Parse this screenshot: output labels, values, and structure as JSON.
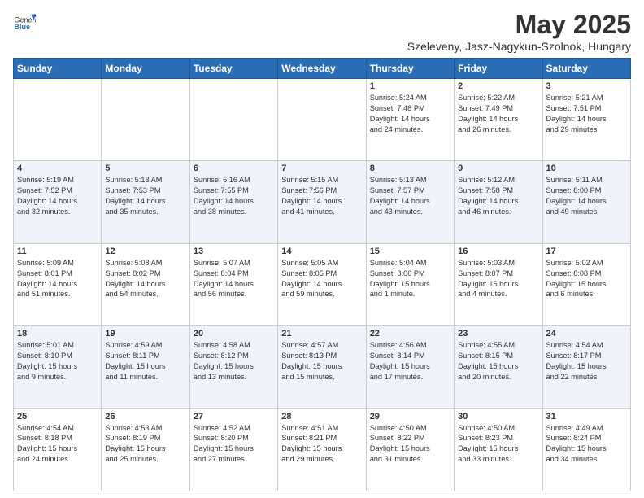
{
  "header": {
    "logo_general": "General",
    "logo_blue": "Blue",
    "main_title": "May 2025",
    "sub_title": "Szeleveny, Jasz-Nagykun-Szolnok, Hungary"
  },
  "weekdays": [
    "Sunday",
    "Monday",
    "Tuesday",
    "Wednesday",
    "Thursday",
    "Friday",
    "Saturday"
  ],
  "weeks": [
    [
      {
        "day": "",
        "info": ""
      },
      {
        "day": "",
        "info": ""
      },
      {
        "day": "",
        "info": ""
      },
      {
        "day": "",
        "info": ""
      },
      {
        "day": "1",
        "info": "Sunrise: 5:24 AM\nSunset: 7:48 PM\nDaylight: 14 hours\nand 24 minutes."
      },
      {
        "day": "2",
        "info": "Sunrise: 5:22 AM\nSunset: 7:49 PM\nDaylight: 14 hours\nand 26 minutes."
      },
      {
        "day": "3",
        "info": "Sunrise: 5:21 AM\nSunset: 7:51 PM\nDaylight: 14 hours\nand 29 minutes."
      }
    ],
    [
      {
        "day": "4",
        "info": "Sunrise: 5:19 AM\nSunset: 7:52 PM\nDaylight: 14 hours\nand 32 minutes."
      },
      {
        "day": "5",
        "info": "Sunrise: 5:18 AM\nSunset: 7:53 PM\nDaylight: 14 hours\nand 35 minutes."
      },
      {
        "day": "6",
        "info": "Sunrise: 5:16 AM\nSunset: 7:55 PM\nDaylight: 14 hours\nand 38 minutes."
      },
      {
        "day": "7",
        "info": "Sunrise: 5:15 AM\nSunset: 7:56 PM\nDaylight: 14 hours\nand 41 minutes."
      },
      {
        "day": "8",
        "info": "Sunrise: 5:13 AM\nSunset: 7:57 PM\nDaylight: 14 hours\nand 43 minutes."
      },
      {
        "day": "9",
        "info": "Sunrise: 5:12 AM\nSunset: 7:58 PM\nDaylight: 14 hours\nand 46 minutes."
      },
      {
        "day": "10",
        "info": "Sunrise: 5:11 AM\nSunset: 8:00 PM\nDaylight: 14 hours\nand 49 minutes."
      }
    ],
    [
      {
        "day": "11",
        "info": "Sunrise: 5:09 AM\nSunset: 8:01 PM\nDaylight: 14 hours\nand 51 minutes."
      },
      {
        "day": "12",
        "info": "Sunrise: 5:08 AM\nSunset: 8:02 PM\nDaylight: 14 hours\nand 54 minutes."
      },
      {
        "day": "13",
        "info": "Sunrise: 5:07 AM\nSunset: 8:04 PM\nDaylight: 14 hours\nand 56 minutes."
      },
      {
        "day": "14",
        "info": "Sunrise: 5:05 AM\nSunset: 8:05 PM\nDaylight: 14 hours\nand 59 minutes."
      },
      {
        "day": "15",
        "info": "Sunrise: 5:04 AM\nSunset: 8:06 PM\nDaylight: 15 hours\nand 1 minute."
      },
      {
        "day": "16",
        "info": "Sunrise: 5:03 AM\nSunset: 8:07 PM\nDaylight: 15 hours\nand 4 minutes."
      },
      {
        "day": "17",
        "info": "Sunrise: 5:02 AM\nSunset: 8:08 PM\nDaylight: 15 hours\nand 6 minutes."
      }
    ],
    [
      {
        "day": "18",
        "info": "Sunrise: 5:01 AM\nSunset: 8:10 PM\nDaylight: 15 hours\nand 9 minutes."
      },
      {
        "day": "19",
        "info": "Sunrise: 4:59 AM\nSunset: 8:11 PM\nDaylight: 15 hours\nand 11 minutes."
      },
      {
        "day": "20",
        "info": "Sunrise: 4:58 AM\nSunset: 8:12 PM\nDaylight: 15 hours\nand 13 minutes."
      },
      {
        "day": "21",
        "info": "Sunrise: 4:57 AM\nSunset: 8:13 PM\nDaylight: 15 hours\nand 15 minutes."
      },
      {
        "day": "22",
        "info": "Sunrise: 4:56 AM\nSunset: 8:14 PM\nDaylight: 15 hours\nand 17 minutes."
      },
      {
        "day": "23",
        "info": "Sunrise: 4:55 AM\nSunset: 8:15 PM\nDaylight: 15 hours\nand 20 minutes."
      },
      {
        "day": "24",
        "info": "Sunrise: 4:54 AM\nSunset: 8:17 PM\nDaylight: 15 hours\nand 22 minutes."
      }
    ],
    [
      {
        "day": "25",
        "info": "Sunrise: 4:54 AM\nSunset: 8:18 PM\nDaylight: 15 hours\nand 24 minutes."
      },
      {
        "day": "26",
        "info": "Sunrise: 4:53 AM\nSunset: 8:19 PM\nDaylight: 15 hours\nand 25 minutes."
      },
      {
        "day": "27",
        "info": "Sunrise: 4:52 AM\nSunset: 8:20 PM\nDaylight: 15 hours\nand 27 minutes."
      },
      {
        "day": "28",
        "info": "Sunrise: 4:51 AM\nSunset: 8:21 PM\nDaylight: 15 hours\nand 29 minutes."
      },
      {
        "day": "29",
        "info": "Sunrise: 4:50 AM\nSunset: 8:22 PM\nDaylight: 15 hours\nand 31 minutes."
      },
      {
        "day": "30",
        "info": "Sunrise: 4:50 AM\nSunset: 8:23 PM\nDaylight: 15 hours\nand 33 minutes."
      },
      {
        "day": "31",
        "info": "Sunrise: 4:49 AM\nSunset: 8:24 PM\nDaylight: 15 hours\nand 34 minutes."
      }
    ]
  ]
}
